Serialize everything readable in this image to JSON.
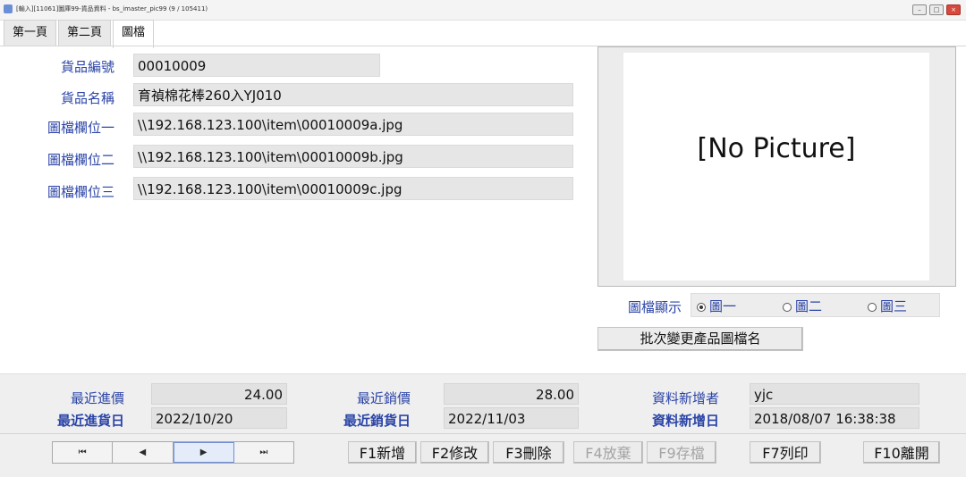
{
  "window": {
    "title": "[輸入][11061]圖庫99-貨品資料 - bs_imaster_pic99  (9 / 105411)",
    "buttons": [
      "–",
      "□",
      "×"
    ]
  },
  "tabs": [
    {
      "label": "第一頁",
      "active": false
    },
    {
      "label": "第二頁",
      "active": false
    },
    {
      "label": "圖檔",
      "active": true
    }
  ],
  "form": {
    "item_no_label": "貨品編號",
    "item_no": "00010009",
    "item_name_label": "貨品名稱",
    "item_name": "育禎棉花棒260入YJ010",
    "pic1_label": "圖檔欄位一",
    "pic1": "\\\\192.168.123.100\\item\\00010009a.jpg",
    "pic2_label": "圖檔欄位二",
    "pic2": "\\\\192.168.123.100\\item\\00010009b.jpg",
    "pic3_label": "圖檔欄位三",
    "pic3": "\\\\192.168.123.100\\item\\00010009c.jpg"
  },
  "picture": {
    "placeholder": "[No Picture]",
    "display_label": "圖檔顯示",
    "options": [
      {
        "label": "圖一",
        "selected": true
      },
      {
        "label": "圖二",
        "selected": false
      },
      {
        "label": "圖三",
        "selected": false
      }
    ],
    "batch_button": "批次變更產品圖檔名"
  },
  "footer": {
    "last_purchase_price_label": "最近進價",
    "last_purchase_price": "24.00",
    "last_purchase_date_label": "最近進貨日",
    "last_purchase_date": "2022/10/20",
    "last_sale_price_label": "最近銷價",
    "last_sale_price": "28.00",
    "last_sale_date_label": "最近銷貨日",
    "last_sale_date": "2022/11/03",
    "created_by_label": "資料新增者",
    "created_by": "yjc",
    "created_at_label": "資料新增日",
    "created_at": "2018/08/07 16:38:38"
  },
  "navigation": {
    "first": "⏮",
    "prev": "◀",
    "next": "▶",
    "last": "⏭"
  },
  "actions": {
    "add": "F1新增",
    "edit": "F2修改",
    "delete": "F3刪除",
    "discard": "F4放棄",
    "save": "F9存檔",
    "print": "F7列印",
    "exit": "F10離開"
  },
  "colors": {
    "label_blue": "#2b44a7",
    "field_gray": "#e6e6e6"
  }
}
